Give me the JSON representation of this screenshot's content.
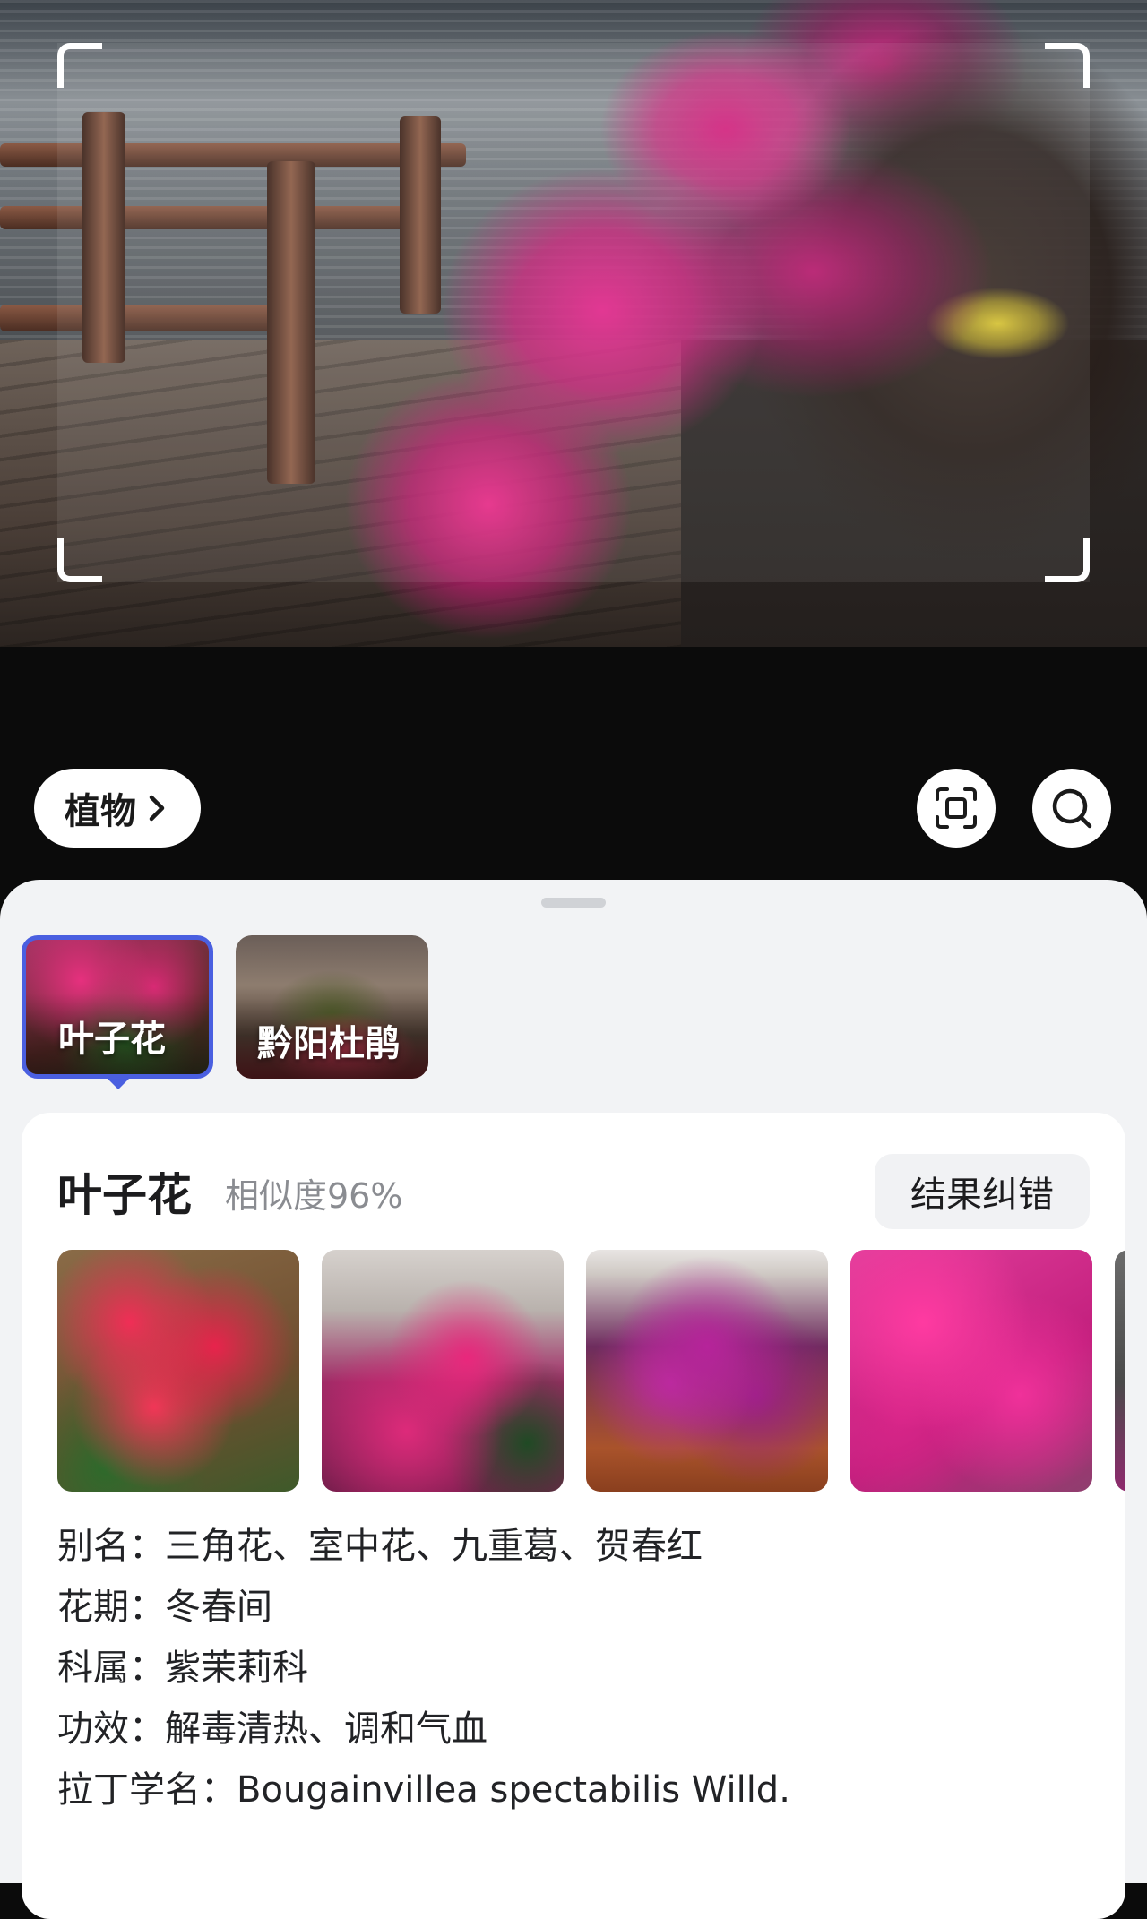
{
  "controls": {
    "category_label": "植物",
    "scan_icon": "scan-icon",
    "search_icon": "search-icon"
  },
  "candidates": [
    {
      "label": "叶子花",
      "selected": true
    },
    {
      "label": "黔阳杜鹃",
      "selected": false
    }
  ],
  "result": {
    "name": "叶子花",
    "similarity": "相似度96%",
    "report_button": "结果纠错",
    "gallery_count_visible": 5,
    "info": [
      {
        "key": "别名：",
        "value": "三角花、室中花、九重葛、贺春红"
      },
      {
        "key": "花期：",
        "value": "冬春间"
      },
      {
        "key": "科属：",
        "value": "紫茉莉科"
      },
      {
        "key": "功效：",
        "value": "解毒清热、调和气血"
      },
      {
        "key": "拉丁学名：",
        "value": "Bougainvillea spectabilis Willd."
      }
    ]
  },
  "colors": {
    "accent": "#4a5fe0",
    "sheet_bg": "#f2f3f5",
    "card_bg": "#ffffff",
    "muted_text": "#8a8c91"
  }
}
